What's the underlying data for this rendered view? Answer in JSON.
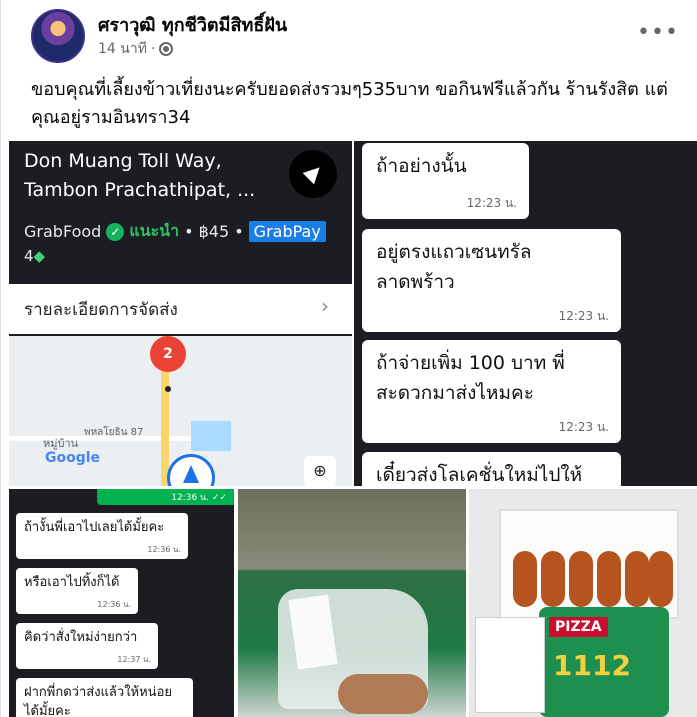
{
  "post": {
    "author": "ศราวุฒิ ทุกชีวิตมีสิทธิ์ฝัน",
    "time": "14 นาที",
    "separator": "·",
    "more_label": "•••",
    "text": "ขอบคุณที่เลี้ยงข้าวเที่ยงนะครับยอดส่งรวมๆ535บาท ขอกินฟรีแล้วกัน ร้านรังสิต แต่คุณอยู่รามอินทรา34"
  },
  "order": {
    "address_line1": "Don Muang Toll Way,",
    "address_line2": "Tambon Prachathipat, ...",
    "service": "GrabFood",
    "recommend": "แนะนำ",
    "price": "• ฿45 •",
    "payment": "GrabPay",
    "gems": "4",
    "delivery_details": "รายละเอียดการจัดส่ง",
    "chevron": "›",
    "map_pin": "2",
    "map_label_village": "หมู่บ้าน",
    "map_label_road": "พหลโยธิน 87",
    "map_brand": "Google",
    "map_add_pin": "⊕"
  },
  "chat_top": [
    {
      "text": "ถ้าอย่างนั้น",
      "time": "12:23 น."
    },
    {
      "text": "อยู่ตรงแถวเซนทรัลลาดพร้าว",
      "time": "12:23 น."
    },
    {
      "text": "ถ้าจ่ายเพิ่ม 100 บาท พี่สะดวกมาส่งไหมคะ",
      "time": "12:23 น."
    },
    {
      "text": "เดี๋ยวส่งโลเคชั่นใหม่ไปให้",
      "time": ""
    }
  ],
  "chat_bottom": {
    "sent_time": "12:36 น. ✓✓",
    "messages": [
      {
        "text": "ถ้างั้นพี่เอาไปเลยได้มั้ยคะ",
        "time": "12:36 น."
      },
      {
        "text": "หรือเอาไปทิ้งก็ได้",
        "time": "12:36 น."
      },
      {
        "text": "คิดว่าสั่งใหม่ง่ายกว่า",
        "time": "12:37 น."
      },
      {
        "text": "ฝากพี่กดว่าส่งแล้วให้หน่อยได้มั้ยคะ",
        "time": ""
      }
    ]
  },
  "photo_box": {
    "logo": "PIZZA",
    "number": "1112"
  },
  "colors": {
    "grab_green": "#00b14f",
    "grabpay_blue": "#1b7ee6",
    "chat_bg": "#1c1d22"
  }
}
